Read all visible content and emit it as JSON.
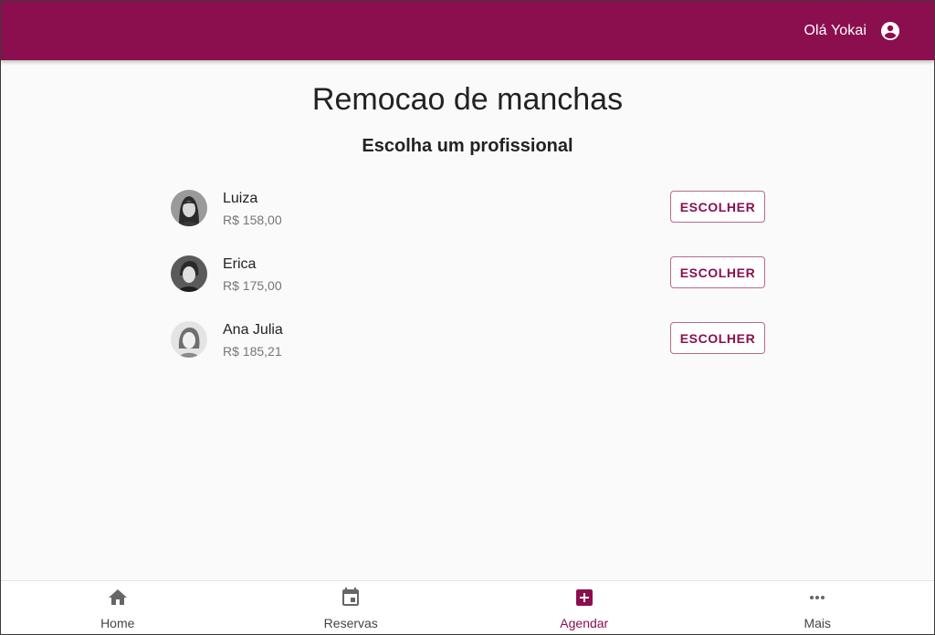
{
  "header": {
    "greeting": "Olá Yokai",
    "account_icon": "account-circle-icon"
  },
  "service": {
    "title": "Remocao de manchas",
    "subtitle": "Escolha um profissional"
  },
  "professionals": [
    {
      "name": "Luiza",
      "price": "R$ 158,00",
      "button": "ESCOLHER"
    },
    {
      "name": "Erica",
      "price": "R$ 175,00",
      "button": "ESCOLHER"
    },
    {
      "name": "Ana Julia",
      "price": "R$ 185,21",
      "button": "ESCOLHER"
    }
  ],
  "bottom_nav": [
    {
      "label": "Home",
      "icon": "home-icon",
      "active": false
    },
    {
      "label": "Reservas",
      "icon": "calendar-icon",
      "active": false
    },
    {
      "label": "Agendar",
      "icon": "add-box-icon",
      "active": true
    },
    {
      "label": "Mais",
      "icon": "more-horizontal-icon",
      "active": false
    }
  ],
  "colors": {
    "brand": "#8b0f4e",
    "background": "#fafafa",
    "text_secondary": "#757575"
  }
}
